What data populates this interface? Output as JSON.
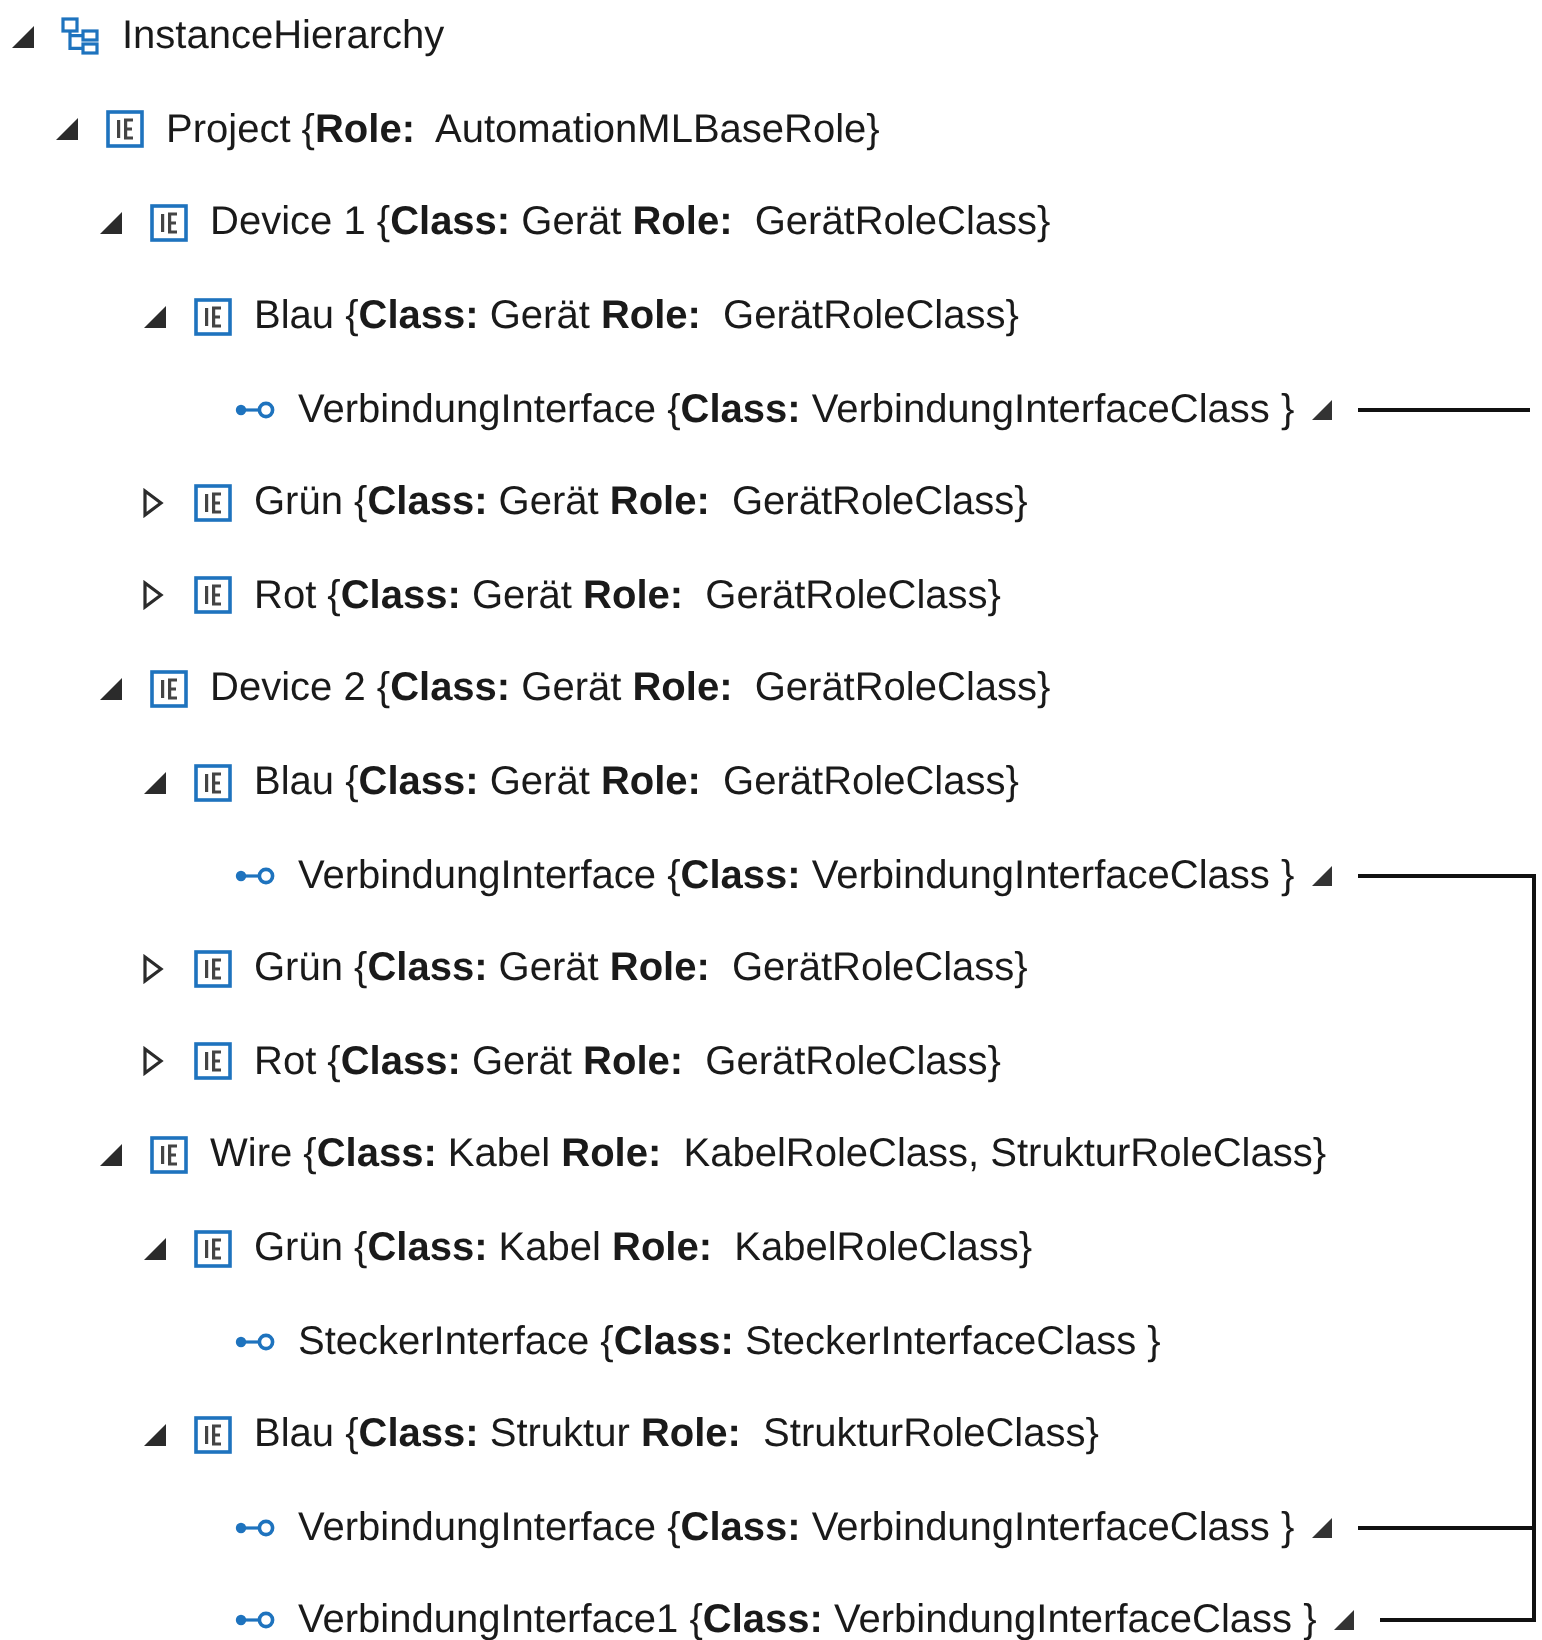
{
  "tree": [
    {
      "kind": "hierarchy",
      "label": "InstanceHierarchy",
      "expanded": true,
      "children": [
        {
          "kind": "element",
          "label": "Project {**Role:**  AutomationMLBaseRole}",
          "expanded": true,
          "children": [
            {
              "kind": "element",
              "label": "Device 1 {**Class:** Gerät **Role:**  GerätRoleClass}",
              "expanded": true,
              "children": [
                {
                  "kind": "element",
                  "label": "Blau {**Class:** Gerät **Role:**  GerätRoleClass}",
                  "expanded": true,
                  "children": [
                    {
                      "kind": "interface",
                      "label": "VerbindungInterface {**Class:** VerbindungInterfaceClass }",
                      "linked": true,
                      "connected": false
                    }
                  ]
                },
                {
                  "kind": "element",
                  "label": "Grün {**Class:** Gerät **Role:**  GerätRoleClass}",
                  "expanded": false
                },
                {
                  "kind": "element",
                  "label": "Rot {**Class:** Gerät **Role:**  GerätRoleClass}",
                  "expanded": false
                }
              ]
            },
            {
              "kind": "element",
              "label": "Device 2 {**Class:** Gerät **Role:**  GerätRoleClass}",
              "expanded": true,
              "children": [
                {
                  "kind": "element",
                  "label": "Blau {**Class:** Gerät **Role:**  GerätRoleClass}",
                  "expanded": true,
                  "children": [
                    {
                      "kind": "interface",
                      "label": "VerbindungInterface {**Class:** VerbindungInterfaceClass }",
                      "linked": true,
                      "connected": true
                    }
                  ]
                },
                {
                  "kind": "element",
                  "label": "Grün {**Class:** Gerät **Role:**  GerätRoleClass}",
                  "expanded": false
                },
                {
                  "kind": "element",
                  "label": "Rot {**Class:** Gerät **Role:**  GerätRoleClass}",
                  "expanded": false
                }
              ]
            },
            {
              "kind": "element",
              "label": "Wire {**Class:** Kabel **Role:**  KabelRoleClass, StrukturRoleClass}",
              "expanded": true,
              "children": [
                {
                  "kind": "element",
                  "label": "Grün {**Class:** Kabel **Role:**  KabelRoleClass}",
                  "expanded": true,
                  "children": [
                    {
                      "kind": "interface",
                      "label": "SteckerInterface {**Class:** SteckerInterfaceClass }",
                      "linked": false
                    }
                  ]
                },
                {
                  "kind": "element",
                  "label": "Blau {**Class:** Struktur **Role:**  StrukturRoleClass}",
                  "expanded": true,
                  "children": [
                    {
                      "kind": "interface",
                      "label": "VerbindungInterface {**Class:** VerbindungInterfaceClass }",
                      "linked": true,
                      "connected": true
                    },
                    {
                      "kind": "interface",
                      "label": "VerbindungInterface1 {**Class:** VerbindungInterfaceClass }",
                      "linked": true,
                      "connected": true
                    }
                  ]
                }
              ]
            }
          ]
        }
      ]
    }
  ]
}
